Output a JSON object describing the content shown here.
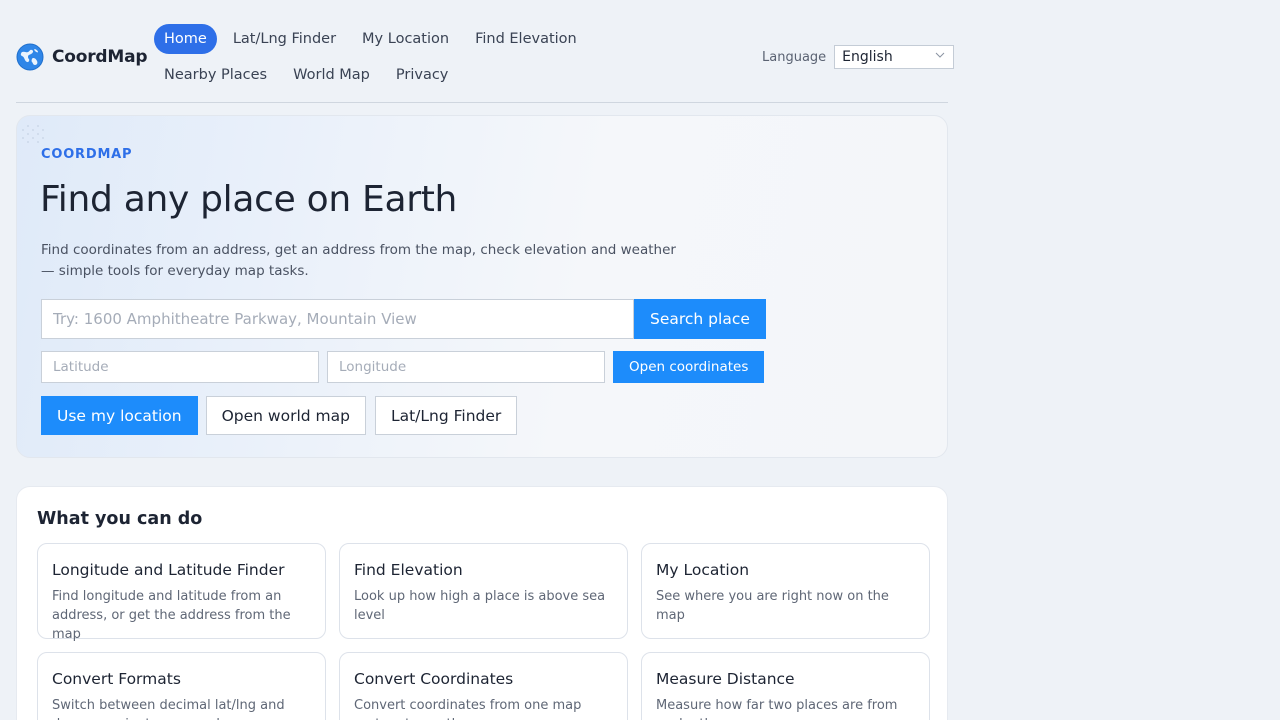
{
  "header": {
    "brand": "CoordMap",
    "nav": [
      {
        "label": "Home",
        "active": true
      },
      {
        "label": "Lat/Lng Finder",
        "active": false
      },
      {
        "label": "My Location",
        "active": false
      },
      {
        "label": "Find Elevation",
        "active": false
      },
      {
        "label": "Nearby Places",
        "active": false
      },
      {
        "label": "World Map",
        "active": false
      },
      {
        "label": "Privacy",
        "active": false
      }
    ],
    "language_label": "Language",
    "language_value": "English"
  },
  "hero": {
    "eyebrow": "COORDMAP",
    "title": "Find any place on Earth",
    "description": "Find coordinates from an address, get an address from the map, check elevation and weather — simple tools for everyday map tasks.",
    "search_placeholder": "Try: 1600 Amphitheatre Parkway, Mountain View",
    "search_button": "Search place",
    "latitude_placeholder": "Latitude",
    "longitude_placeholder": "Longitude",
    "open_coordinates_button": "Open coordinates",
    "use_location_button": "Use my location",
    "world_map_button": "Open world map",
    "latlng_finder_button": "Lat/Lng Finder"
  },
  "features": {
    "title": "What you can do",
    "cards": [
      {
        "title": "Longitude and Latitude Finder",
        "desc": "Find longitude and latitude from an address, or get the address from the map"
      },
      {
        "title": "Find Elevation",
        "desc": "Look up how high a place is above sea level"
      },
      {
        "title": "My Location",
        "desc": "See where you are right now on the map"
      },
      {
        "title": "Convert Formats",
        "desc": "Switch between decimal lat/lng and degrees, minutes, seconds"
      },
      {
        "title": "Convert Coordinates",
        "desc": "Convert coordinates from one map system to another"
      },
      {
        "title": "Measure Distance",
        "desc": "Measure how far two places are from each other"
      }
    ]
  },
  "colors": {
    "accent": "#2e6fe8",
    "button": "#1d8cfb",
    "background": "#eef2f7"
  },
  "icons": {
    "logo": "globe-icon",
    "language_dropdown": "chevron-down-icon"
  }
}
